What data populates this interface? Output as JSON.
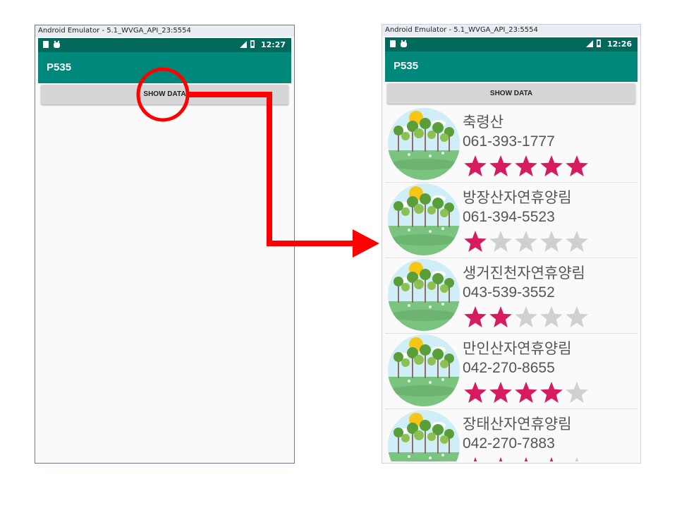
{
  "left_emulator": {
    "window_title": "Android Emulator - 5.1_WVGA_API_23:5554",
    "status_time": "12:27",
    "app_title": "P535",
    "button_label": "SHOW DATA"
  },
  "right_emulator": {
    "window_title": "Android Emulator - 5.1_WVGA_API_23:5554",
    "status_time": "12:26",
    "app_title": "P535",
    "button_label": "SHOW DATA",
    "list": [
      {
        "name": "축령산",
        "phone": "061-393-1777",
        "rating": 5
      },
      {
        "name": "방장산자연휴양림",
        "phone": "061-394-5523",
        "rating": 1
      },
      {
        "name": "생거진천자연휴양림",
        "phone": "043-539-3552",
        "rating": 2
      },
      {
        "name": "만인산자연휴양림",
        "phone": "042-270-8655",
        "rating": 4
      },
      {
        "name": "장태산자연휴양림",
        "phone": "042-270-7883",
        "rating": 4
      }
    ],
    "rating_max": 5
  },
  "colors": {
    "status_bar": "#00695c",
    "app_bar": "#00897b",
    "star_filled": "#d81b60",
    "star_empty": "#d0d0d0",
    "annotation": "#ff0000"
  }
}
